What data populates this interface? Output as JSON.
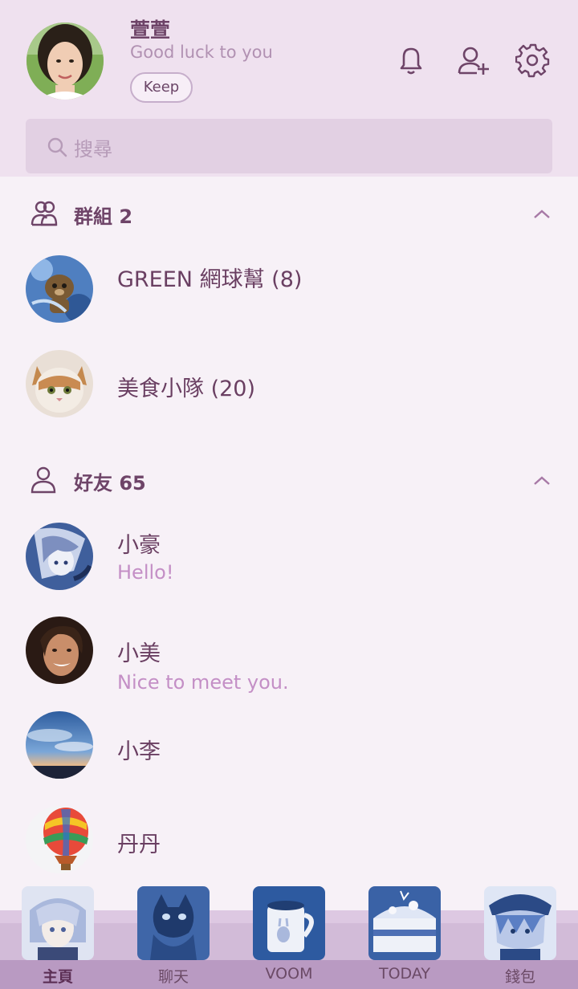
{
  "profile": {
    "name": "萱萱",
    "status": "Good luck to you",
    "keep_label": "Keep"
  },
  "top_icons": [
    "bell-icon",
    "add-friend-icon",
    "gear-icon"
  ],
  "search": {
    "placeholder": "搜尋"
  },
  "groups": {
    "title": "群組 2",
    "items": [
      {
        "name": "GREEN 網球幫 (8)"
      },
      {
        "name": "美食小隊 (20)"
      }
    ]
  },
  "friends": {
    "title": "好友 65",
    "items": [
      {
        "name": "小豪",
        "status": "Hello!"
      },
      {
        "name": "小美",
        "status": "Nice to meet you."
      },
      {
        "name": "小李"
      },
      {
        "name": "丹丹"
      }
    ]
  },
  "tabs": [
    {
      "label": "主頁",
      "active": true
    },
    {
      "label": "聊天"
    },
    {
      "label": "VOOM"
    },
    {
      "label": "TODAY"
    },
    {
      "label": "錢包"
    }
  ],
  "colors": {
    "header_bg": "#efe1ef",
    "body_bg": "#f7f1f7",
    "accent": "#6e4468",
    "status_text": "#c48fc6"
  }
}
